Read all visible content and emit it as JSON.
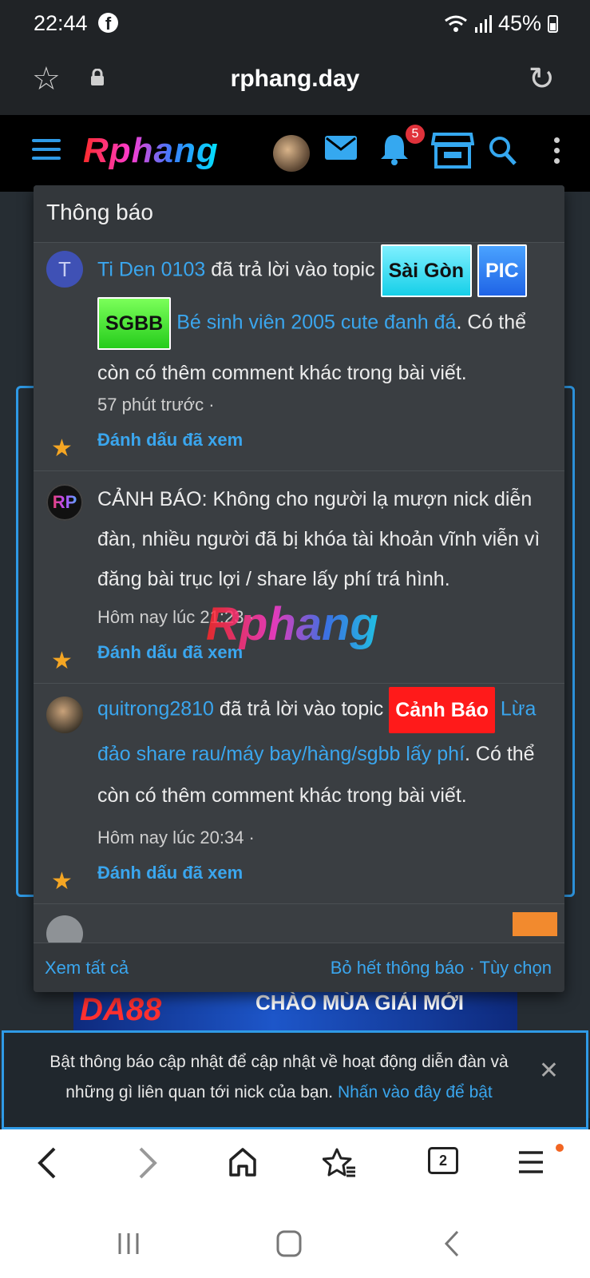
{
  "status_bar": {
    "time": "22:44",
    "battery": "45%",
    "notification_app_icon": "facebook-icon"
  },
  "browser": {
    "url": "rphang.day",
    "tab_count": "2"
  },
  "site_header": {
    "logo": "Rphang",
    "notification_badge": "5"
  },
  "notifications_panel": {
    "title": "Thông báo",
    "items": [
      {
        "avatar_text": "T",
        "user": "Ti Den 0103",
        "action": " đã trả lời vào topic ",
        "tags": [
          "Sài Gòn",
          "PIC",
          "SGBB"
        ],
        "topic": "Bé sinh viên 2005 cute đanh đá",
        "suffix": ". Có thể còn có thêm comment khác trong bài viết.",
        "time": "57 phút trước ·",
        "mark_read": "Đánh dấu đã xem"
      },
      {
        "avatar_text": "RP",
        "message": "CẢNH BÁO: Không cho người lạ mượn nick diễn đàn, nhiều người đã bị khóa tài khoản vĩnh viễn vì đăng bài trục lợi / share lấy phí trá hình.",
        "time": "Hôm nay lúc 21:23 ·",
        "mark_read": "Đánh dấu đã xem"
      },
      {
        "user": "quitrong2810",
        "action": " đã trả lời vào topic ",
        "tags": [
          "Cảnh Báo"
        ],
        "topic": "Lừa đảo share rau/máy bay/hàng/sgbb lấy phí",
        "suffix": ". Có thể còn có thêm comment khác trong bài viết.",
        "time": "Hôm nay lúc 20:34 ·",
        "mark_read": "Đánh dấu đã xem"
      }
    ],
    "footer": {
      "view_all": "Xem tất cả",
      "dismiss_all": "Bỏ hết thông báo",
      "separator": " · ",
      "options": "Tùy chọn"
    }
  },
  "watermark": "Rphang",
  "ad_banner": {
    "brand": "DA88",
    "text": "CHÀO MÙA GIẢI MỚI"
  },
  "push_prompt": {
    "text": "Bật thông báo cập nhật để cập nhật về hoạt động diễn đàn và những gì liên quan tới nick của bạn.",
    "link": "Nhấn vào đây để bật"
  }
}
